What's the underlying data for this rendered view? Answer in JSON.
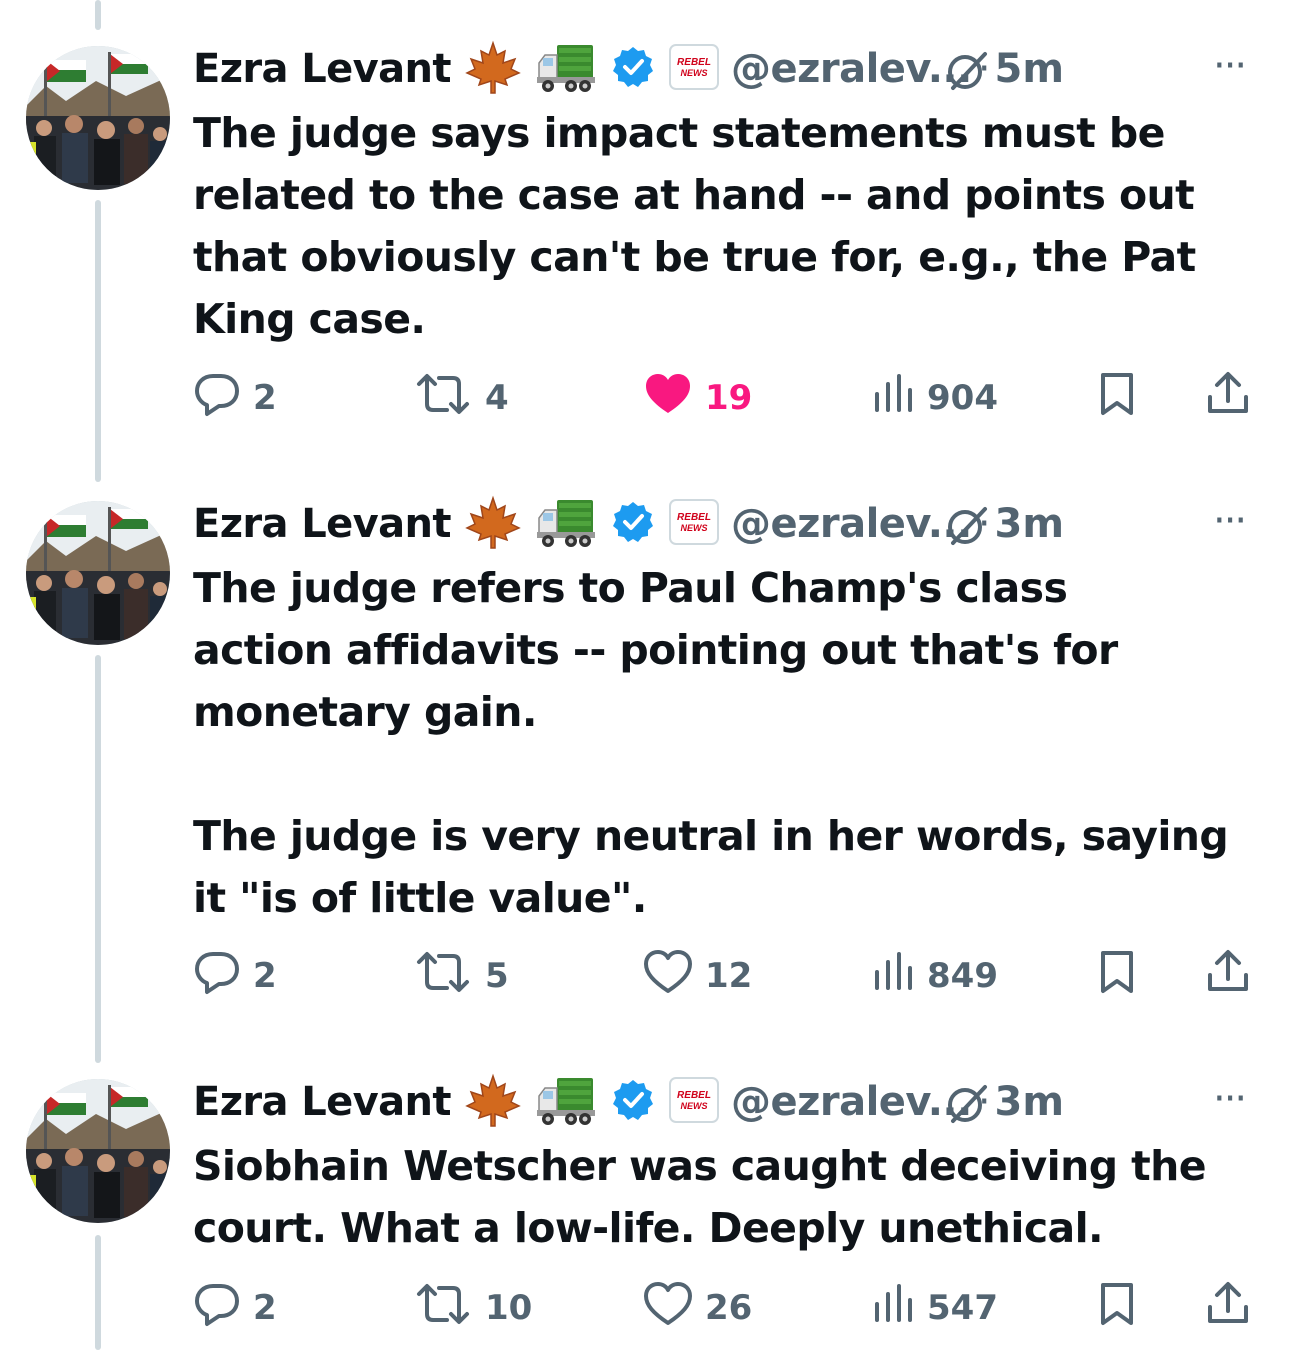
{
  "tweets": [
    {
      "author": {
        "name": "Ezra Levant",
        "handle": "@ezralev...",
        "emojis": [
          "maple-leaf",
          "truck"
        ],
        "verified": true,
        "affiliate_badge": "REBEL NEWS"
      },
      "time": "5m",
      "more_label": "···",
      "text": "The judge says impact statements must be\nrelated to the case at hand -- and points out\nthat obviously can't be true for, e.g., the Pat\nKing case.",
      "stats": {
        "replies": "2",
        "reposts": "4",
        "likes": "19",
        "views": "904"
      },
      "liked": true
    },
    {
      "author": {
        "name": "Ezra Levant",
        "handle": "@ezralev...",
        "emojis": [
          "maple-leaf",
          "truck"
        ],
        "verified": true,
        "affiliate_badge": "REBEL NEWS"
      },
      "time": "3m",
      "more_label": "···",
      "text": "The judge refers to Paul Champ's class\naction affidavits -- pointing out that's for\nmonetary gain.\n\nThe judge is very neutral in her words, saying\nit \"is of little value\".",
      "stats": {
        "replies": "2",
        "reposts": "5",
        "likes": "12",
        "views": "849"
      },
      "liked": false
    },
    {
      "author": {
        "name": "Ezra Levant",
        "handle": "@ezralev...",
        "emojis": [
          "maple-leaf",
          "truck"
        ],
        "verified": true,
        "affiliate_badge": "REBEL NEWS"
      },
      "time": "3m",
      "more_label": "···",
      "text": "Siobhain Wetscher was caught deceiving the\ncourt. What a low-life. Deeply unethical.",
      "stats": {
        "replies": "2",
        "reposts": "10",
        "likes": "26",
        "views": "547"
      },
      "liked": false
    }
  ],
  "separator": "·",
  "colors": {
    "text": "#0f1419",
    "secondary": "#536471",
    "like": "#f91880",
    "verified": "#1d9bf0",
    "thread_line": "#cfd9de"
  }
}
